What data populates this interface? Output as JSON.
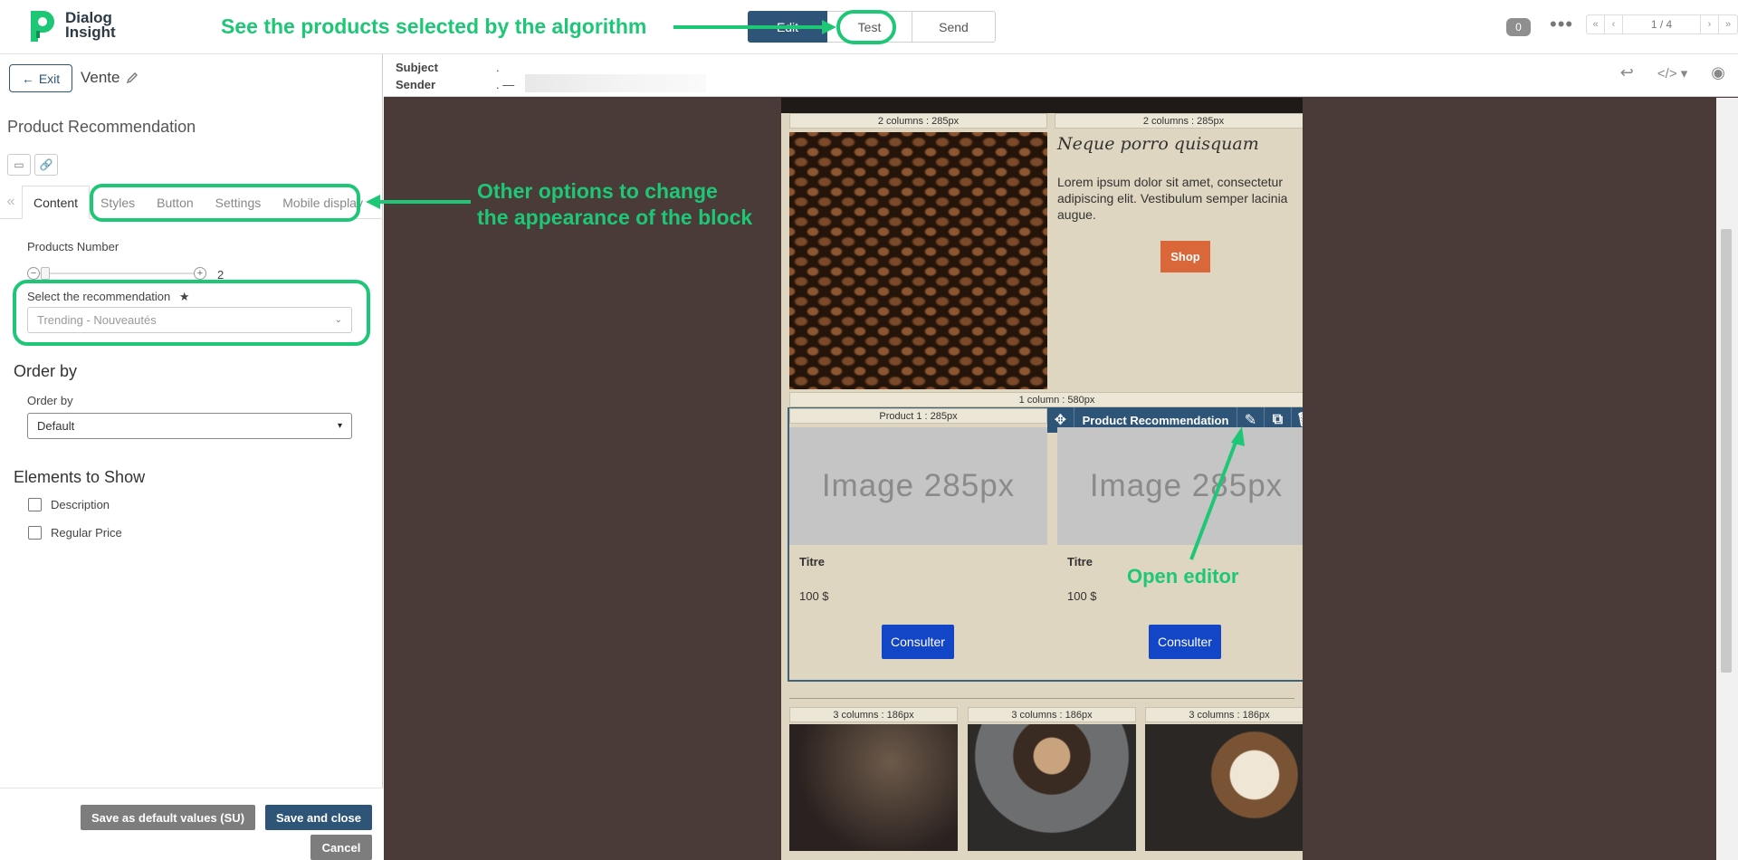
{
  "app": {
    "logo_line1": "Dialog",
    "logo_line2": "Insight"
  },
  "steps": {
    "edit_label": "Edit",
    "test_label": "Test",
    "send_label": "Send"
  },
  "topbar": {
    "count": "0",
    "more": "•••",
    "pager_first": "«",
    "pager_prev": "‹",
    "pager_page": "1 / 4",
    "pager_next": "›",
    "pager_last": "»"
  },
  "left": {
    "exit_label": "Exit",
    "doc_name": "Vente",
    "panel_title": "Product Recommendation",
    "tabs": [
      "Content",
      "Styles",
      "Button",
      "Settings",
      "Mobile display"
    ],
    "products_number_label": "Products Number",
    "products_number_value": "2",
    "select_rec_label": "Select the recommendation",
    "select_rec_value": "Trending - Nouveautés",
    "order_by_section": "Order by",
    "order_by_label": "Order by",
    "order_by_value": "Default",
    "elements_section": "Elements to Show",
    "elements": [
      "Description",
      "Regular Price"
    ],
    "btn_default": "Save as default values (SU)",
    "btn_save_close": "Save and close",
    "btn_cancel": "Cancel"
  },
  "email_header": {
    "subject_label": "Subject",
    "subject_value": ".",
    "sender_label": "Sender",
    "sender_value": ".  —"
  },
  "email": {
    "col2_left": "2 columns : 285px",
    "col2_right": "2 columns : 285px",
    "heading": "Neque porro quisquam",
    "body": "Lorem ipsum dolor sit amet, consectetur adipiscing elit. Vestibulum semper lacinia augue.",
    "shop": "Shop",
    "one_column": "1 column : 580px",
    "product1_label": "Product 1 : 285px",
    "toolbar_title": "Product Recommendation",
    "image_placeholder": "Image 285px",
    "product_title": "Titre",
    "product_price": "100 $",
    "consult": "Consulter",
    "col3": "3 columns : 186px"
  },
  "annotations": {
    "algorithm": "See the products selected by the algorithm",
    "options_line1": "Other options to change",
    "options_line2": "the appearance of the block",
    "open_editor": "Open editor"
  },
  "colors": {
    "annotation": "#1ec776",
    "brand_blue": "#2e5578",
    "email_bg": "#4a3b38",
    "consult_blue": "#1345c7"
  }
}
